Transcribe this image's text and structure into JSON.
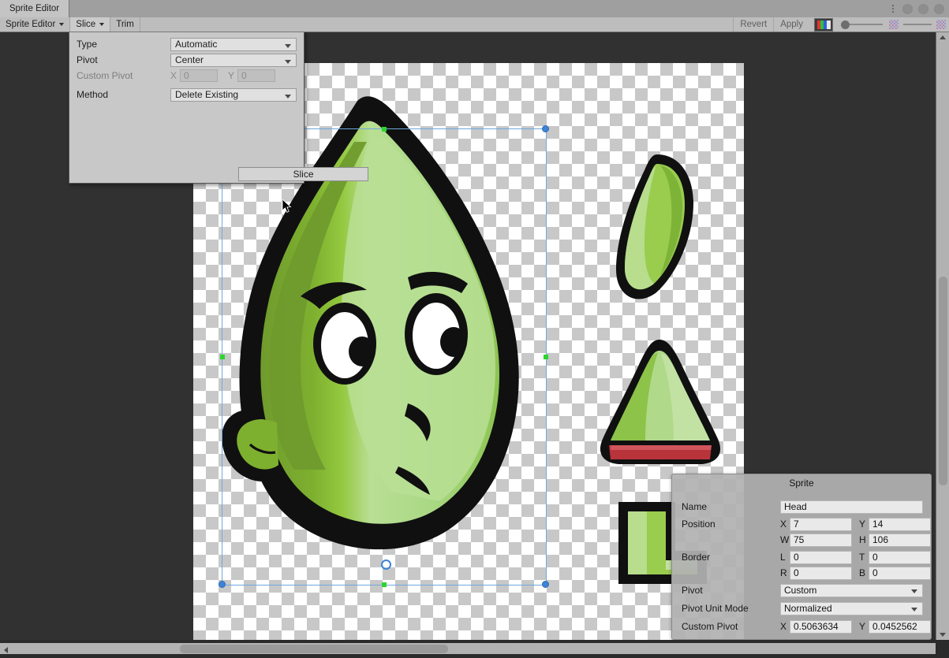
{
  "window": {
    "tab_label": "Sprite Editor",
    "menu_icon": "kebab-menu-icon",
    "dots": [
      "window-dot-1",
      "window-dot-2",
      "window-dot-3"
    ]
  },
  "toolbar": {
    "sprite_editor_menu": "Sprite Editor",
    "slice_menu": "Slice",
    "trim_button": "Trim",
    "revert_button": "Revert",
    "apply_button": "Apply",
    "rgb_button": "rgb-channel-icon",
    "zoom_slider": "zoom-slider",
    "alpha_checker_left": "checker-small-icon",
    "alpha_checker_right": "checker-large-icon"
  },
  "slice_popup": {
    "rows": [
      {
        "label": "Type",
        "value": "Automatic",
        "kind": "dropdown"
      },
      {
        "label": "Pivot",
        "value": "Center",
        "kind": "dropdown"
      },
      {
        "label": "Custom Pivot",
        "value_x": "0",
        "value_y": "0",
        "axis_x": "X",
        "axis_y": "Y",
        "kind": "xy",
        "disabled": true
      },
      {
        "label": "Method",
        "value": "Delete Existing",
        "kind": "dropdown"
      }
    ],
    "slice_button": "Slice"
  },
  "inspector": {
    "title": "Sprite",
    "name_label": "Name",
    "name_value": "Head",
    "position_label": "Position",
    "position": {
      "x_axis": "X",
      "x": "7",
      "y_axis": "Y",
      "y": "14",
      "w_axis": "W",
      "w": "75",
      "h_axis": "H",
      "h": "106"
    },
    "border_label": "Border",
    "border": {
      "l_axis": "L",
      "l": "0",
      "t_axis": "T",
      "t": "0",
      "r_axis": "R",
      "r": "0",
      "b_axis": "B",
      "b": "0"
    },
    "pivot_label": "Pivot",
    "pivot_value": "Custom",
    "pivot_unit_mode_label": "Pivot Unit Mode",
    "pivot_unit_mode_value": "Normalized",
    "custom_pivot_label": "Custom Pivot",
    "custom_pivot": {
      "x_axis": "X",
      "x": "0.5063634",
      "y_axis": "Y",
      "y": "0.0452562"
    }
  },
  "colors": {
    "selection_outline": "#6fa8dc",
    "corner_handle": "#3d84d8",
    "edge_handle": "#2ed42e",
    "panel_bg": "#c8c8c8",
    "toolbar_bg": "#bdbdbd",
    "canvas_bg": "#313131",
    "leaf_dark": "#6f9b2d",
    "leaf_mid": "#8fc63d",
    "leaf_light": "#b5dd8f",
    "outline": "#101010",
    "red_band": "#b8333a"
  },
  "canvas": {
    "sheet_name": "sprite-sheet-checkerboard",
    "sprites": [
      "head-sprite",
      "leaf-blade-sprite",
      "hat-cone-sprite",
      "foot-sprite"
    ]
  },
  "scrollbars": {
    "vertical": "vertical-scrollbar",
    "horizontal": "horizontal-scrollbar"
  }
}
